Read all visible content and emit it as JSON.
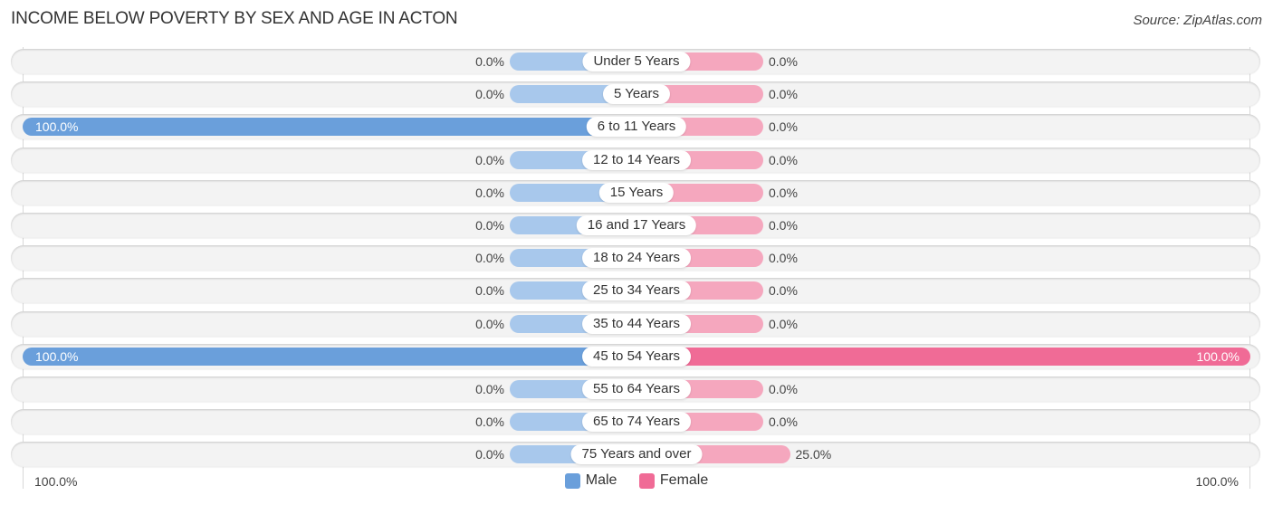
{
  "title": "INCOME BELOW POVERTY BY SEX AND AGE IN ACTON",
  "source": "Source: ZipAtlas.com",
  "colors": {
    "male_full": "#6a9fdb",
    "male_light": "#a8c8ec",
    "female_full": "#f06b96",
    "female_light": "#f5a7be"
  },
  "axis": {
    "left_label": "100.0%",
    "right_label": "100.0%"
  },
  "legend": [
    {
      "label": "Male",
      "color": "#6a9fdb"
    },
    {
      "label": "Female",
      "color": "#f06b96"
    }
  ],
  "chart_data": {
    "type": "bar",
    "orientation": "horizontal-diverging",
    "title": "INCOME BELOW POVERTY BY SEX AND AGE IN ACTON",
    "xlabel": "",
    "ylabel": "",
    "xlim": [
      -100,
      100
    ],
    "legend_position": "bottom-center",
    "categories": [
      "Under 5 Years",
      "5 Years",
      "6 to 11 Years",
      "12 to 14 Years",
      "15 Years",
      "16 and 17 Years",
      "18 to 24 Years",
      "25 to 34 Years",
      "35 to 44 Years",
      "45 to 54 Years",
      "55 to 64 Years",
      "65 to 74 Years",
      "75 Years and over"
    ],
    "series": [
      {
        "name": "Male",
        "values": [
          0.0,
          0.0,
          100.0,
          0.0,
          0.0,
          0.0,
          0.0,
          0.0,
          0.0,
          100.0,
          0.0,
          0.0,
          0.0
        ],
        "labels": [
          "0.0%",
          "0.0%",
          "100.0%",
          "0.0%",
          "0.0%",
          "0.0%",
          "0.0%",
          "0.0%",
          "0.0%",
          "100.0%",
          "0.0%",
          "0.0%",
          "0.0%"
        ]
      },
      {
        "name": "Female",
        "values": [
          0.0,
          0.0,
          0.0,
          0.0,
          0.0,
          0.0,
          0.0,
          0.0,
          0.0,
          100.0,
          0.0,
          0.0,
          25.0
        ],
        "labels": [
          "0.0%",
          "0.0%",
          "0.0%",
          "0.0%",
          "0.0%",
          "0.0%",
          "0.0%",
          "0.0%",
          "0.0%",
          "100.0%",
          "0.0%",
          "0.0%",
          "25.0%"
        ]
      }
    ]
  }
}
